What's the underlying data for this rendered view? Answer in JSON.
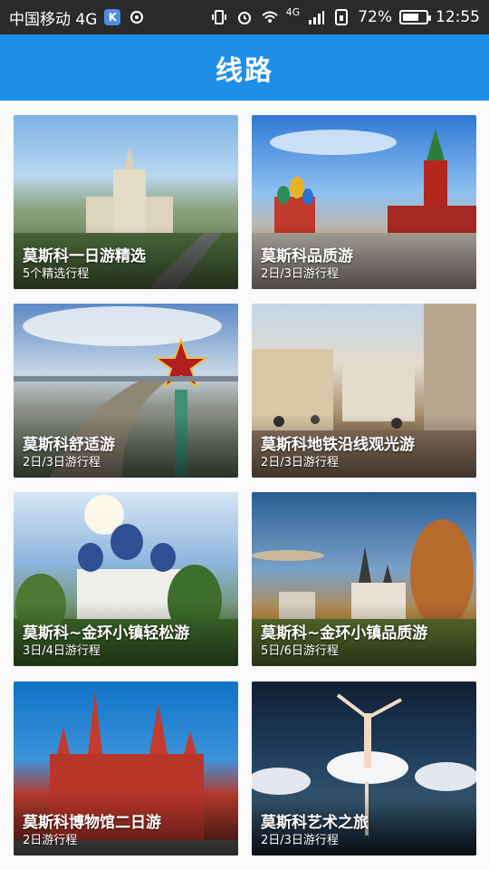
{
  "status_bar": {
    "carrier": "中国移动 4G",
    "k_badge": "K",
    "battery": "72%",
    "battery_level": 0.72,
    "time": "12:55",
    "signal_label": "4G"
  },
  "header": {
    "title": "线路"
  },
  "routes": [
    {
      "title": "莫斯科一日游精选",
      "subtitle": "5个精选行程"
    },
    {
      "title": "莫斯科品质游",
      "subtitle": "2日/3日游行程"
    },
    {
      "title": "莫斯科舒适游",
      "subtitle": "2日/3日游行程"
    },
    {
      "title": "莫斯科地铁沿线观光游",
      "subtitle": "2日/3日游行程"
    },
    {
      "title": "莫斯科~金环小镇轻松游",
      "subtitle": "3日/4日游行程"
    },
    {
      "title": "莫斯科~金环小镇品质游",
      "subtitle": "5日/6日游行程"
    },
    {
      "title": "莫斯科博物馆二日游",
      "subtitle": "2日游行程"
    },
    {
      "title": "莫斯科艺术之旅",
      "subtitle": "2日/3日游行程"
    }
  ]
}
